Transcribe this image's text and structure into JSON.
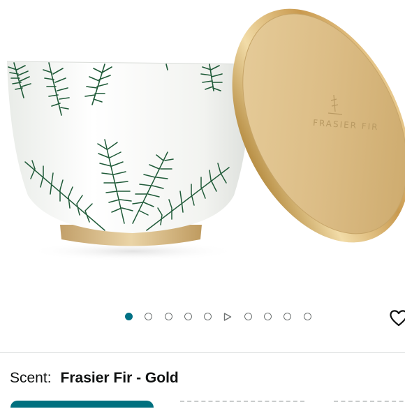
{
  "product": {
    "lid_branding": "FRASIER FIR"
  },
  "carousel": {
    "dot_count": 10,
    "active_index": 0,
    "video_index": 5
  },
  "wishlist": {
    "icon": "heart-icon"
  },
  "variation": {
    "label": "Scent:",
    "value": "Frasier Fir - Gold"
  },
  "colors": {
    "accent": "#007185",
    "selected_swatch": "#00707f",
    "gold": "#d9b77c",
    "pine": "#1f5a38"
  }
}
